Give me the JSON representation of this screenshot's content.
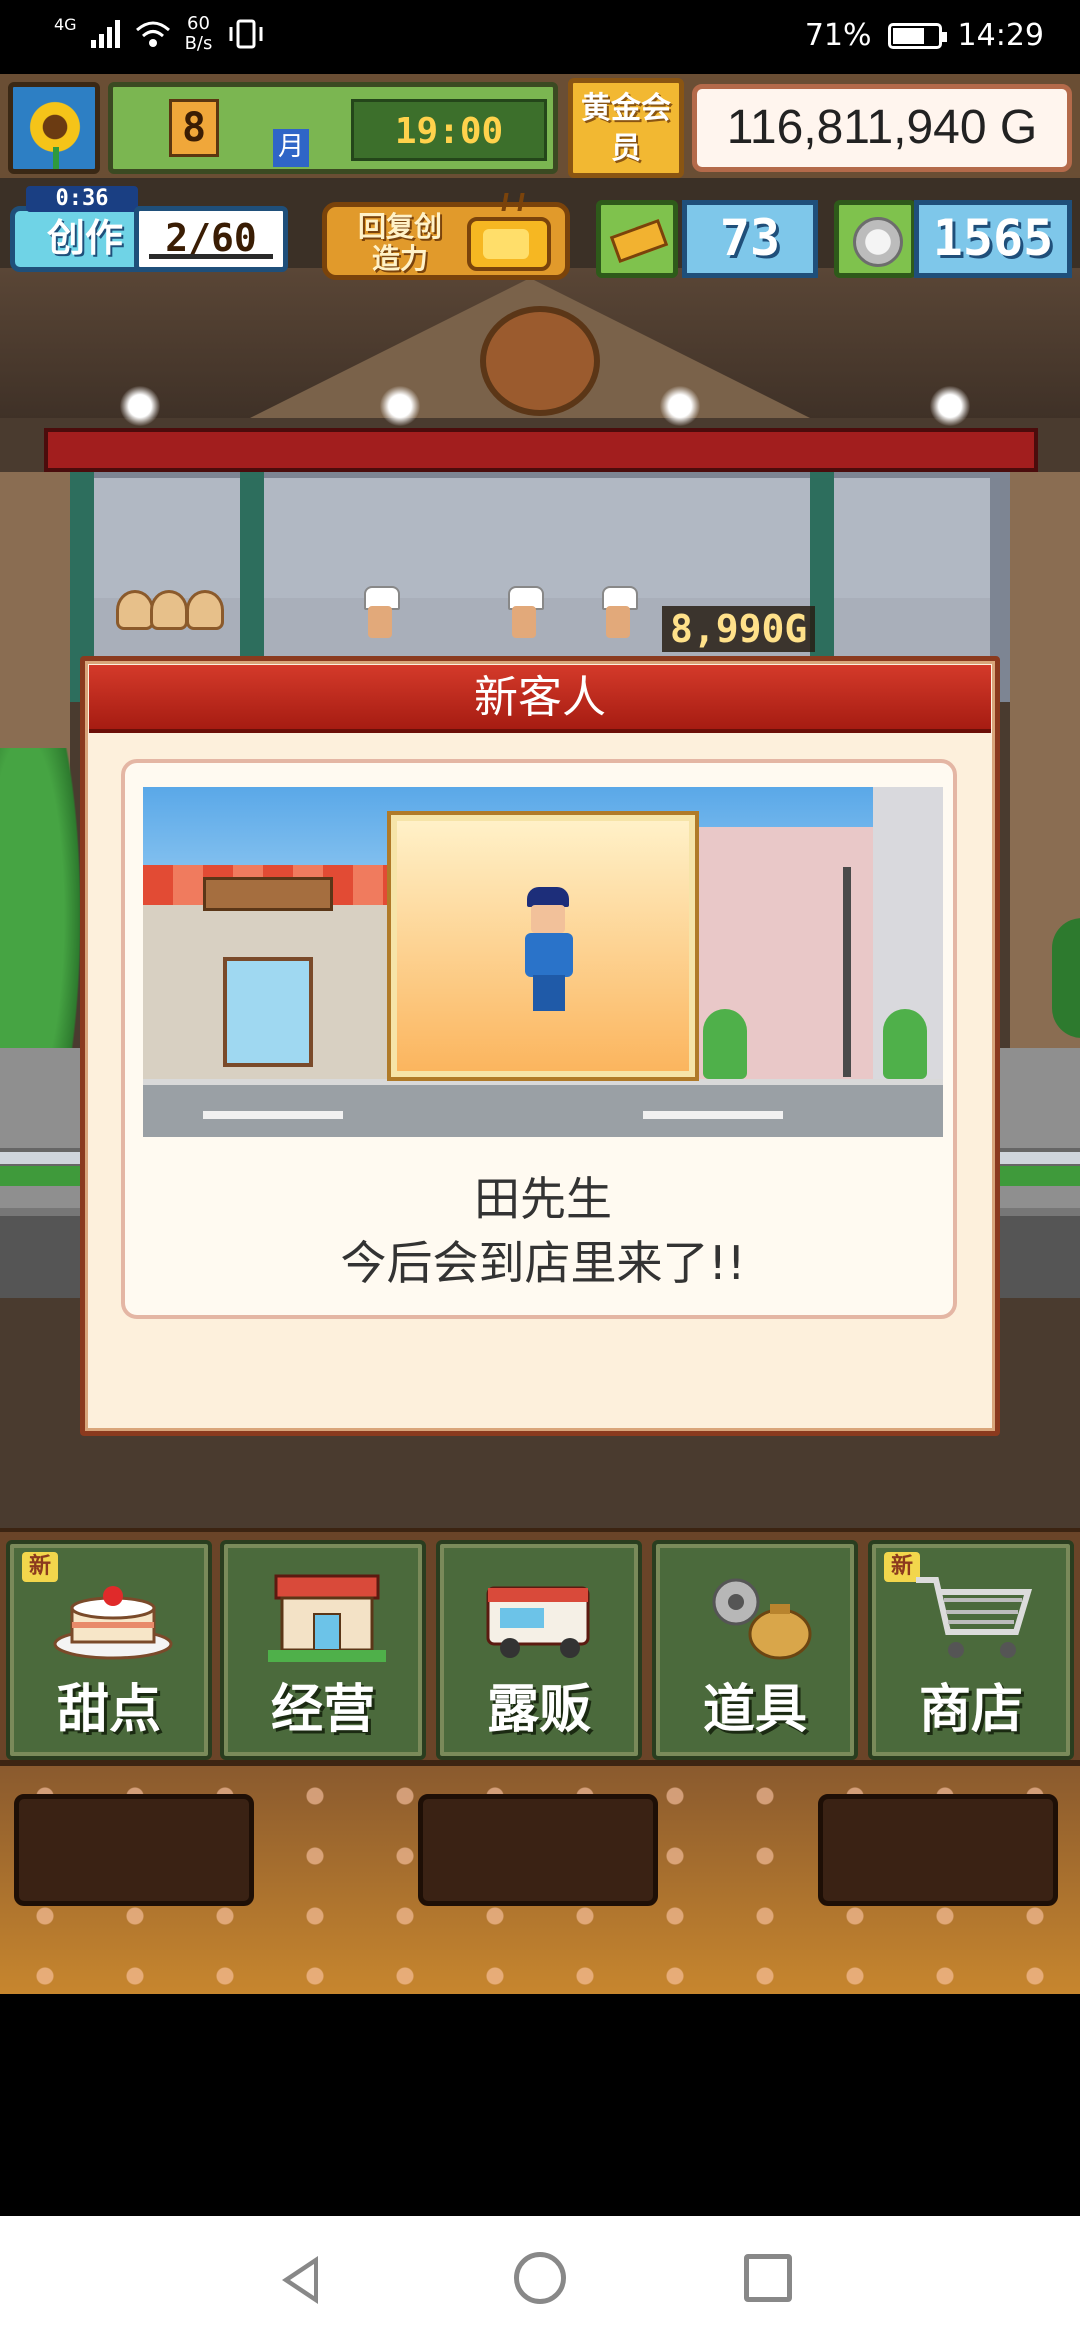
{
  "status_bar": {
    "network": "4G",
    "speed_value": "60",
    "speed_unit": "B/s",
    "battery": "71%",
    "battery_level": 0.71,
    "time": "14:29"
  },
  "hud": {
    "month": "8",
    "month_label": "月",
    "clock": "19:00",
    "gold_member_label": "黄金会员",
    "money": "116,811,940 G",
    "create_timer": "0:36",
    "create_label": "创作",
    "create_count": "2/60",
    "restore_label": "回复创造力",
    "tickets": "73",
    "coins": "1565"
  },
  "scene": {
    "price_tag": "8,990G"
  },
  "dialog": {
    "title": "新客人",
    "customer_name": "田先生",
    "message": "今后会到店里来了!!"
  },
  "menu": {
    "items": [
      {
        "label": "甜点",
        "badge": "新",
        "icon": "cake-icon"
      },
      {
        "label": "经营",
        "badge": "",
        "icon": "shop-icon"
      },
      {
        "label": "露贩",
        "badge": "",
        "icon": "food-truck-icon"
      },
      {
        "label": "道具",
        "badge": "",
        "icon": "tools-bag-icon"
      },
      {
        "label": "商店",
        "badge": "新",
        "icon": "shopping-cart-icon"
      }
    ]
  },
  "colors": {
    "dialog_header": "#c22a1c",
    "dialog_bg": "#fdf0dc",
    "menu_bg": "#4b6a3c",
    "hud_green": "#7bb651",
    "gold": "#f2b832"
  }
}
